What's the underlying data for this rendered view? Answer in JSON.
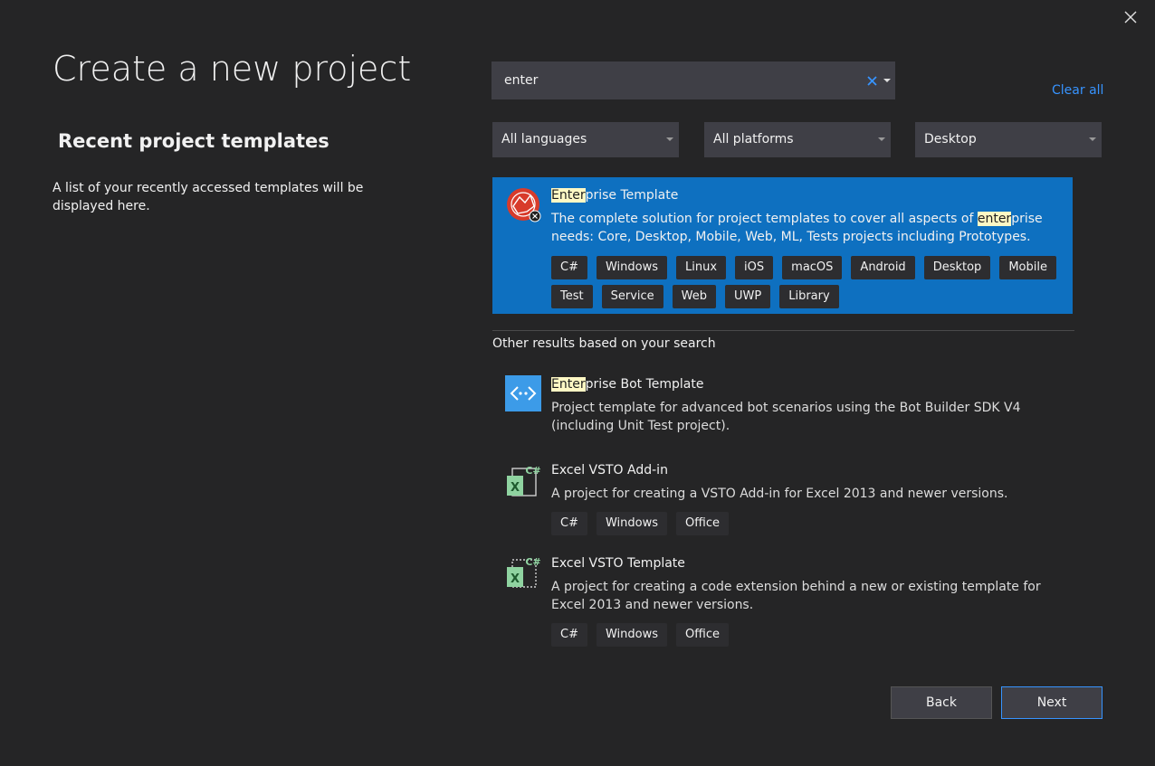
{
  "title": "Create a new project",
  "recent": {
    "heading": "Recent project templates",
    "description": "A list of your recently accessed templates will be displayed here."
  },
  "search": {
    "value": "enter",
    "clear_all": "Clear all"
  },
  "filters": {
    "language": "All languages",
    "platform": "All platforms",
    "project_type": "Desktop"
  },
  "selected_template": {
    "name_highlight": "Enter",
    "name_rest": "prise Template",
    "desc_before": "The complete solution for project templates to cover all aspects of ",
    "desc_highlight": "enter",
    "desc_after": "prise needs: Core, Desktop, Mobile, Web, ML, Tests projects including Prototypes.",
    "tags": [
      "C#",
      "Windows",
      "Linux",
      "iOS",
      "macOS",
      "Android",
      "Desktop",
      "Mobile",
      "Test",
      "Service",
      "Web",
      "UWP",
      "Library"
    ]
  },
  "other_results": {
    "heading": "Other results based on your search",
    "items": [
      {
        "name_highlight": "Enter",
        "name_rest": "prise Bot Template",
        "description": "Project template for advanced bot scenarios using the Bot Builder SDK V4 (including Unit Test project).",
        "tags": []
      },
      {
        "name": "Excel VSTO Add-in",
        "description": "A project for creating a VSTO Add-in for Excel 2013 and newer versions.",
        "tags": [
          "C#",
          "Windows",
          "Office"
        ]
      },
      {
        "name": "Excel VSTO Template",
        "description": "A project for creating a code extension behind a new or existing template for Excel 2013 and newer versions.",
        "tags": [
          "C#",
          "Windows",
          "Office"
        ]
      }
    ]
  },
  "buttons": {
    "back": "Back",
    "next": "Next"
  },
  "colors": {
    "background": "#252526",
    "selected": "#0e70c0",
    "accent_link": "#3794ff",
    "highlight": "#fff8c4"
  },
  "icons": {
    "close": "close-icon",
    "search_clear": "clear-x-icon",
    "dropdown": "chevron-down-icon",
    "enterprise": "enterprise-template-icon",
    "bot": "bot-code-icon",
    "excel": "excel-csharp-icon"
  }
}
